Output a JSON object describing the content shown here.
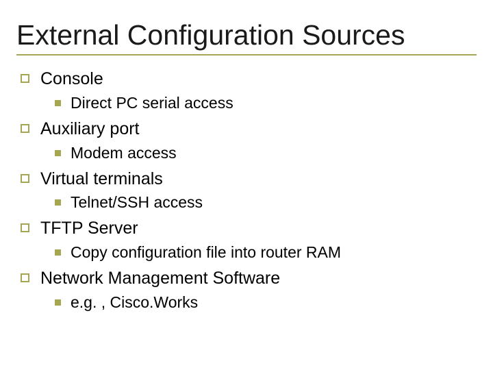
{
  "title": "External Configuration Sources",
  "items": [
    {
      "label": "Console",
      "sub": [
        {
          "label": "Direct PC serial access"
        }
      ]
    },
    {
      "label": "Auxiliary port",
      "sub": [
        {
          "label": "Modem access"
        }
      ]
    },
    {
      "label": "Virtual terminals",
      "sub": [
        {
          "label": "Telnet/SSH access"
        }
      ]
    },
    {
      "label": "TFTP Server",
      "sub": [
        {
          "label": "Copy configuration file into router RAM"
        }
      ]
    },
    {
      "label": "Network Management Software",
      "sub": [
        {
          "label": "e.g. , Cisco.Works"
        }
      ]
    }
  ]
}
